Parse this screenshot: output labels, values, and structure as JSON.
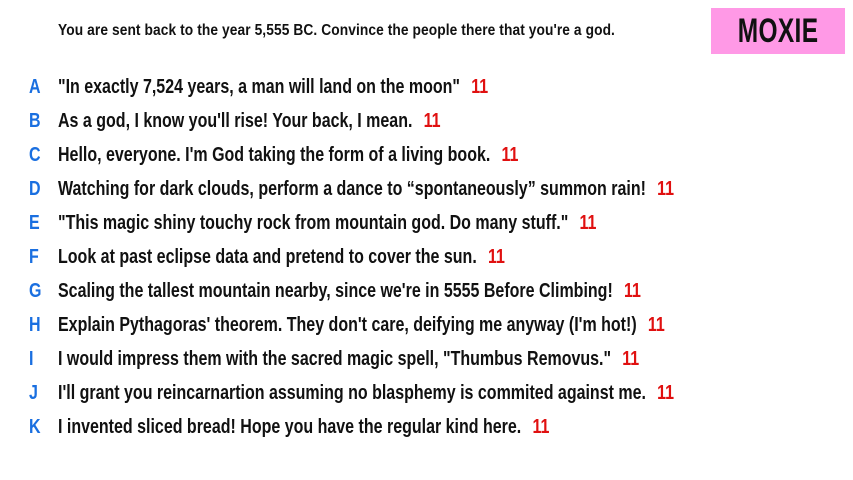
{
  "prompt": "You are sent back to the year 5,555 BC. Convince the people there that you're a god.",
  "logo": "MOXIE",
  "colors": {
    "letter": "#1a6fe0",
    "score": "#e01010",
    "logo_bg": "#ff99e6"
  },
  "answers": [
    {
      "letter": "A",
      "text": "\"In exactly 7,524 years, a man will land on the moon\"",
      "score": "11"
    },
    {
      "letter": "B",
      "text": "As a god, I know you'll rise! Your back, I mean.",
      "score": "11"
    },
    {
      "letter": "C",
      "text": "Hello, everyone. I'm God taking the form of a living book.",
      "score": "11"
    },
    {
      "letter": "D",
      "text": "Watching for dark clouds, perform a dance to “spontaneously” summon rain!",
      "score": "11"
    },
    {
      "letter": "E",
      "text": "\"This magic shiny touchy rock from mountain god. Do many stuff.\"",
      "score": "11"
    },
    {
      "letter": "F",
      "text": "Look at past eclipse data and pretend to cover the sun.",
      "score": "11"
    },
    {
      "letter": "G",
      "text": "Scaling the tallest mountain nearby, since we're in 5555 Before Climbing!",
      "score": "11"
    },
    {
      "letter": "H",
      "text": "Explain Pythagoras' theorem. They don't care, deifying me anyway (I'm hot!)",
      "score": "11"
    },
    {
      "letter": "I",
      "text": "I would impress them with the sacred magic spell, \"Thumbus Removus.\"",
      "score": "11"
    },
    {
      "letter": "J",
      "text": "I'll grant you reincarnartion assuming no blasphemy is commited against me.",
      "score": "11"
    },
    {
      "letter": "K",
      "text": "I invented sliced bread! Hope you have the regular kind here.",
      "score": "11"
    }
  ]
}
